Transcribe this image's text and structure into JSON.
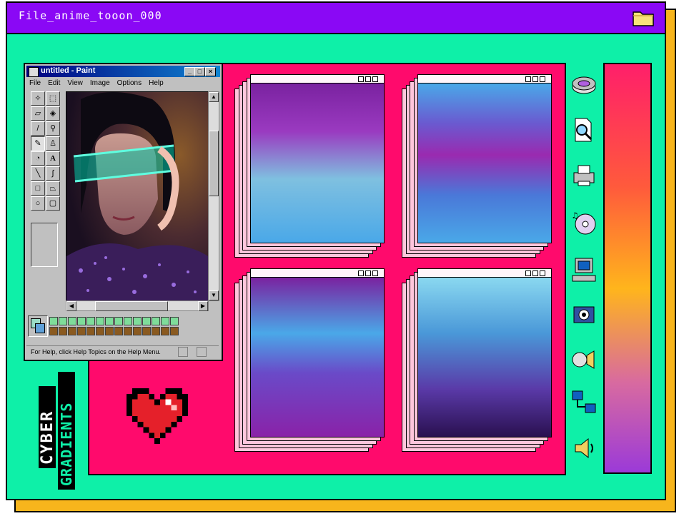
{
  "window": {
    "title": "File_anime_tooon_000"
  },
  "paint": {
    "title": "untitled - Paint",
    "menu": [
      "File",
      "Edit",
      "View",
      "Image",
      "Options",
      "Help"
    ],
    "status": "For Help, click Help Topics on the Help Menu."
  },
  "brand": {
    "line1": "CYBER",
    "line2": "GRADIENTS"
  },
  "icons": [
    "disk-drive-icon",
    "file-search-icon",
    "printer-icon",
    "music-cd-icon",
    "computer-icon",
    "camera-icon",
    "sound-settings-icon",
    "network-icon",
    "speaker-icon"
  ],
  "colors": {
    "background": "#0ef0a8",
    "titlebar": "#8a08f5",
    "panel": "#ff0a6c",
    "shadow": "#f7b51c"
  }
}
